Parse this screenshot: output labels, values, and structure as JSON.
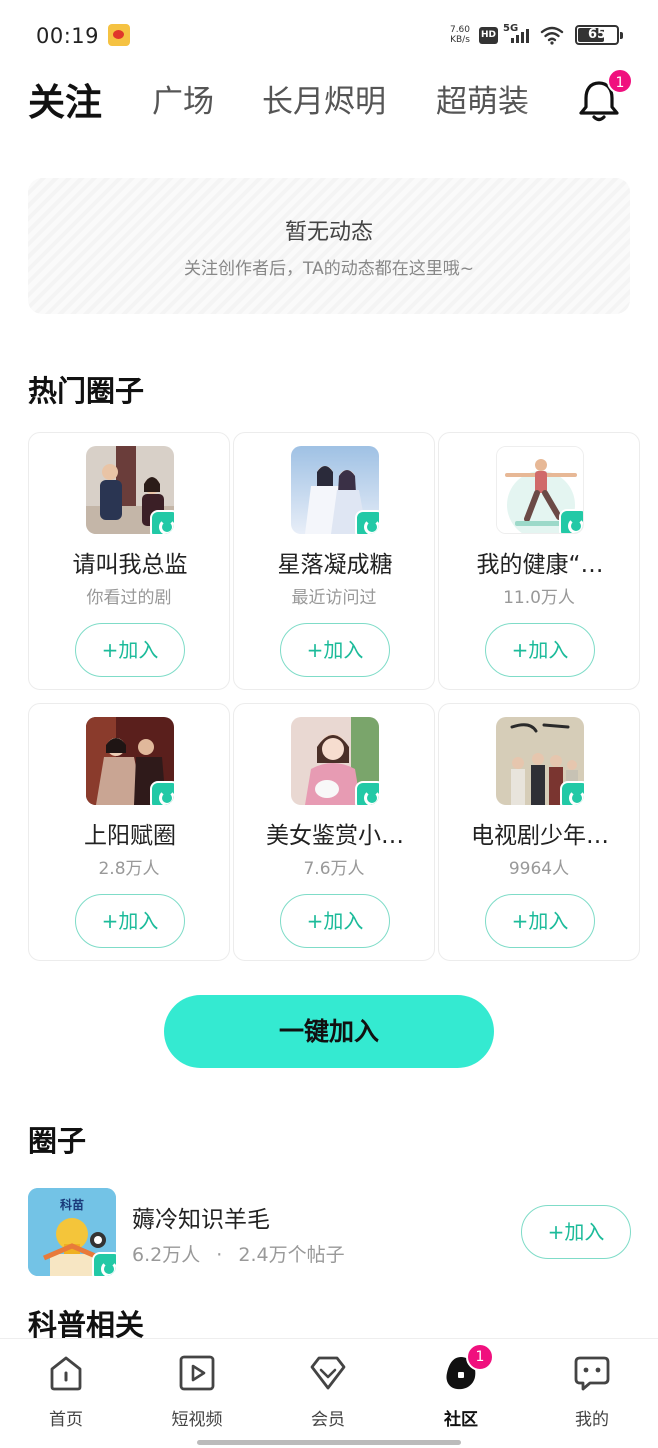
{
  "status_bar": {
    "time": "00:19",
    "net_speed_value": "7.60",
    "net_speed_unit": "KB/s",
    "hd_label": "HD",
    "network_label": "5G",
    "battery_level": "65",
    "battery_fraction": 0.65
  },
  "top_tabs": [
    {
      "label": "关注",
      "active": true
    },
    {
      "label": "广场",
      "active": false
    },
    {
      "label": "长月烬明",
      "active": false
    },
    {
      "label": "超萌装",
      "active": false
    }
  ],
  "notifications": {
    "badge": "1"
  },
  "empty_state": {
    "title": "暂无动态",
    "subtitle": "关注创作者后，TA的动态都在这里哦~"
  },
  "hot_circles": {
    "title": "热门圈子",
    "join_label": "+加入",
    "items": [
      {
        "name": "请叫我总监",
        "sub": "你看过的剧"
      },
      {
        "name": "星落凝成糖",
        "sub": "最近访问过"
      },
      {
        "name": "我的健康“…",
        "sub": "11.0万人"
      },
      {
        "name": "上阳赋圈",
        "sub": "2.8万人"
      },
      {
        "name": "美女鉴赏小…",
        "sub": "7.6万人"
      },
      {
        "name": "电视剧少年…",
        "sub": "9964人"
      }
    ]
  },
  "one_key_join": "一键加入",
  "circles_section": {
    "title": "圈子",
    "item": {
      "avatar_text": "科苗",
      "name": "薅冷知识羊毛",
      "members": "6.2万人",
      "separator": "·",
      "posts": "2.4万个帖子",
      "join_label": "+加入"
    }
  },
  "related_section": {
    "title": "科普相关"
  },
  "bottom_nav": {
    "items": [
      {
        "label": "首页",
        "icon": "home-icon"
      },
      {
        "label": "短视频",
        "icon": "play-icon"
      },
      {
        "label": "会员",
        "icon": "diamond-icon"
      },
      {
        "label": "社区",
        "icon": "community-icon",
        "active": true
      },
      {
        "label": "我的",
        "icon": "profile-icon"
      }
    ],
    "community_badge": "1"
  },
  "colors": {
    "accent": "#34ead1",
    "accent_text": "#1cbb9a",
    "badge": "#f0107e"
  }
}
